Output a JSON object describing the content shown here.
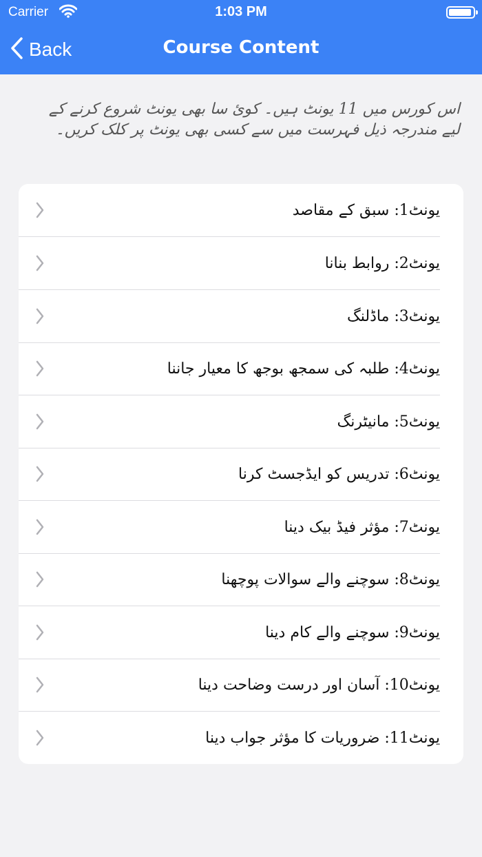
{
  "status_bar": {
    "carrier": "Carrier",
    "time": "1:03 PM"
  },
  "nav": {
    "back_label": "Back",
    "title": "Course Content"
  },
  "intro_text": "اس کورس میں 11 یونٹ ہیں۔ کوئ سا بھی یونٹ شروع کرنے کے لیے مندرجہ ذیل فہرست میں سے کسی بھی یونٹ پر کلک کریں۔",
  "units": [
    {
      "label": "یونٹ1: سبق کے مقاصد"
    },
    {
      "label": "یونٹ2: روابط بنانا"
    },
    {
      "label": "یونٹ3: ماڈلنگ"
    },
    {
      "label": "یونٹ4: طلبہ کی سمجھ بوجھ کا معیار جاننا"
    },
    {
      "label": "یونٹ5: مانیٹرنگ"
    },
    {
      "label": "یونٹ6: تدریس کو ایڈجسٹ کرنا"
    },
    {
      "label": "یونٹ7: مؤثر فیڈ بیک دینا"
    },
    {
      "label": "یونٹ8: سوچنے والے سوالات پوچھنا"
    },
    {
      "label": "یونٹ9: سوچنے والے کام دینا"
    },
    {
      "label": "یونٹ10: آسان اور درست وضاحت دینا"
    },
    {
      "label": "یونٹ11: ضروریات کا مؤثر جواب دینا"
    }
  ],
  "colors": {
    "accent": "#3b82f6",
    "background": "#f2f2f4"
  },
  "icons": {
    "back": "chevron-left-icon",
    "row": "chevron-right-icon",
    "wifi": "wifi-icon",
    "battery": "battery-icon"
  }
}
